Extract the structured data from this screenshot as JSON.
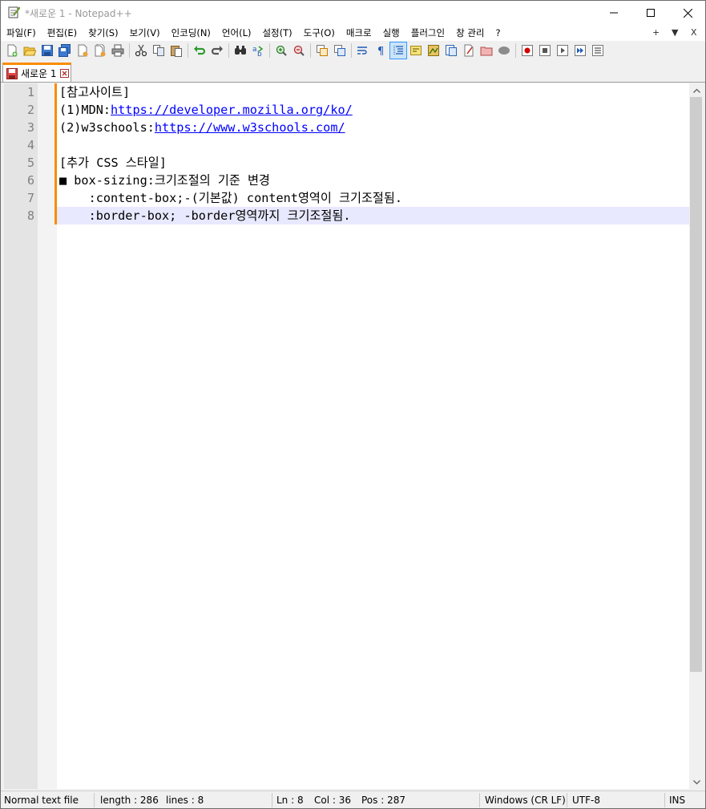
{
  "window": {
    "title": "*새로운 1 - Notepad++"
  },
  "menu": {
    "items": [
      "파일(F)",
      "편집(E)",
      "찾기(S)",
      "보기(V)",
      "인코딩(N)",
      "언어(L)",
      "설정(T)",
      "도구(O)",
      "매크로",
      "실행",
      "플러그인",
      "창 관리",
      "?"
    ],
    "right_plus": "+",
    "right_arrow": "▼",
    "right_close": "X"
  },
  "tabs": [
    {
      "label": "새로운 1"
    }
  ],
  "editor": {
    "line_numbers": [
      "1",
      "2",
      "3",
      "4",
      "5",
      "6",
      "7",
      "8"
    ],
    "lines": [
      {
        "text": "[참고사이트]"
      },
      {
        "prefix": "(1)MDN:",
        "link": "https://developer.mozilla.org/ko/"
      },
      {
        "prefix": "(2)w3schools:",
        "link": "https://www.w3schools.com/"
      },
      {
        "text": ""
      },
      {
        "text": "[추가 CSS 스타일]"
      },
      {
        "text": "■ box-sizing:크기조절의 기준 변경"
      },
      {
        "text": "    :content-box;-(기본값) content영역이 크기조절됨."
      },
      {
        "text": "    :border-box; -border영역까지 크기조절됨."
      }
    ],
    "current_line": 8
  },
  "status": {
    "file_type": "Normal text file",
    "length": "length : 286",
    "lines": "lines : 8",
    "ln": "Ln : 8",
    "col": "Col : 36",
    "pos": "Pos : 287",
    "eol": "Windows (CR LF)",
    "encoding": "UTF-8",
    "mode": "INS"
  },
  "colors": {
    "accent_tab": "#fa8c00",
    "link": "#0000ff",
    "current_line_bg": "#e8e8ff",
    "gutter_bg": "#e4e4e4"
  },
  "toolbar_icons": [
    "new-file-icon",
    "open-file-icon",
    "save-icon",
    "save-all-icon",
    "close-icon",
    "close-all-icon",
    "print-icon",
    "cut-icon",
    "copy-icon",
    "paste-icon",
    "undo-icon",
    "redo-icon",
    "find-icon",
    "replace-icon",
    "zoom-in-icon",
    "zoom-out-icon",
    "sync-vertical-icon",
    "sync-horizontal-icon",
    "word-wrap-icon",
    "show-all-chars-icon",
    "indent-guide-icon",
    "user-language-icon",
    "doc-map-icon",
    "function-list-icon",
    "folder-workspace-icon",
    "doc-list-icon",
    "monitoring-icon",
    "record-macro-icon",
    "stop-macro-icon",
    "play-macro-icon",
    "run-macro-multiple-icon",
    "save-macro-icon"
  ]
}
